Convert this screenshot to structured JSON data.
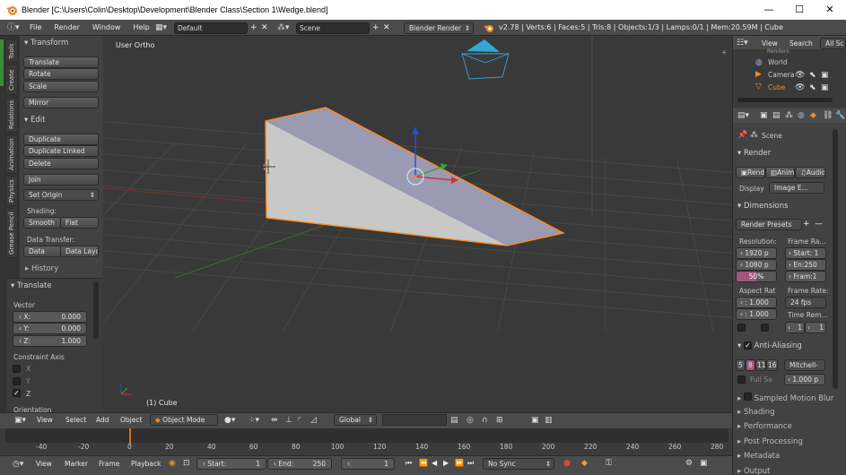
{
  "window": {
    "title": "Blender [C:\\Users\\Colin\\Desktop\\Development\\Blender Class\\Section 1\\Wedge.blend]",
    "minimize": "—",
    "maximize": "☐",
    "close": "✕"
  },
  "menubar": {
    "items": [
      "File",
      "Render",
      "Window",
      "Help"
    ],
    "layout": "Default",
    "scene": "Scene",
    "engine": "Blender Render",
    "stats": "v2.78 | Verts:6 | Faces:5 | Tris:8 | Objects:1/3 | Lamps:0/1 | Mem:20.59M | Cube"
  },
  "toolshelf": {
    "tabs": [
      "Tools",
      "Create",
      "Relations",
      "Animation",
      "Physics",
      "Grease Pencil"
    ],
    "transform_header": "Transform",
    "translate": "Translate",
    "rotate": "Rotate",
    "scale": "Scale",
    "mirror": "Mirror",
    "edit_header": "Edit",
    "duplicate": "Duplicate",
    "duplicate_linked": "Duplicate Linked",
    "delete": "Delete",
    "join": "Join",
    "set_origin": "Set Origin",
    "shading_label": "Shading:",
    "smooth": "Smooth",
    "flat": "Flat",
    "data_transfer_label": "Data Transfer:",
    "data": "Data",
    "data_layo": "Data Layo",
    "history_header": "History"
  },
  "operator": {
    "header": "Translate",
    "vector_label": "Vector",
    "x_label": "X:",
    "x_value": "0.000",
    "y_label": "Y:",
    "y_value": "0.000",
    "z_label": "Z:",
    "z_value": "1.000",
    "constraint_label": "Constraint Axis",
    "cx": "X",
    "cy": "Y",
    "cz": "Z",
    "orientation_label": "Orientation"
  },
  "viewport": {
    "view_label": "User Ortho",
    "object_label": "(1) Cube"
  },
  "viewport_header": {
    "view": "View",
    "select": "Select",
    "add": "Add",
    "object": "Object",
    "mode": "Object Mode",
    "orientation": "Global"
  },
  "timeline": {
    "ticks": [
      "-40",
      "-20",
      "0",
      "20",
      "40",
      "60",
      "80",
      "100",
      "120",
      "140",
      "160",
      "180",
      "200",
      "220",
      "240",
      "260",
      "280"
    ],
    "current_frame": 1,
    "view": "View",
    "marker": "Marker",
    "frame": "Frame",
    "playback": "Playback",
    "start_label": "Start:",
    "start_value": "1",
    "end_label": "End:",
    "end_value": "250",
    "frame_value": "1",
    "sync": "No Sync"
  },
  "outliner": {
    "view": "View",
    "search": "Search",
    "all_scenes": "All Sc",
    "items": [
      "World",
      "Camera",
      "Cube"
    ],
    "cut_item": "Renders"
  },
  "properties": {
    "scene": "Scene",
    "render_header": "Render",
    "render_btn": "Rend",
    "anim_btn": "Anim",
    "audio_btn": "Audio",
    "display_label": "Display",
    "display_value": "Image E...",
    "dimensions_header": "Dimensions",
    "render_presets": "Render Presets",
    "resolution_label": "Resolution:",
    "frame_range_label": "Frame Ra...",
    "res_x": "1920 p",
    "res_y": "1080 p",
    "res_pct": "50%",
    "res_pct_value": 0.5,
    "start": "Start: 1",
    "end": "En:250",
    "fram": "Fram:1",
    "aspect_label": "Aspect Rat",
    "frame_rate_label": "Frame Rate:",
    "aspect_x": ": 1.000",
    "aspect_y": ": 1.000",
    "fps": "24 fps",
    "time_remap_label": "Time Rem...",
    "tr_a": "1",
    "tr_b": "1",
    "aa_header": "Anti-Aliasing",
    "aa_samples": [
      "5",
      "8",
      "11",
      "16"
    ],
    "aa_filter": "Mitchell-",
    "full_sample": "Full Sa",
    "aa_size": "1.000 p",
    "motion_blur": "Sampled Motion Blur",
    "shading": "Shading",
    "performance": "Performance",
    "post_processing": "Post Processing",
    "metadata": "Metadata",
    "output": "Output"
  },
  "colors": {
    "selection_orange": "#ff8a1e",
    "active_sample": "#a0567e",
    "camera_blue": "#33a5d6"
  }
}
